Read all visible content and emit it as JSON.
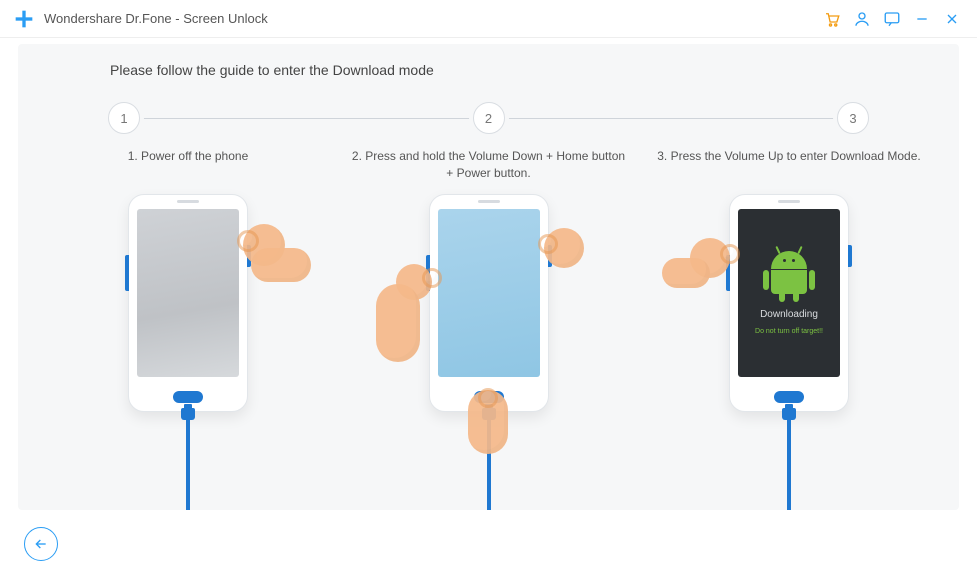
{
  "titlebar": {
    "app_title": "Wondershare Dr.Fone - Screen Unlock"
  },
  "guide": {
    "title": "Please follow the guide to enter the Download mode",
    "steps": {
      "s1": {
        "num": "1",
        "caption": "1. Power off the phone"
      },
      "s2": {
        "num": "2",
        "caption": "2. Press and hold the Volume Down + Home button + Power button."
      },
      "s3": {
        "num": "3",
        "caption": "3. Press the Volume Up to enter Download Mode."
      }
    },
    "download_screen": {
      "label": "Downloading",
      "sub": "Do not turn off target!!"
    }
  }
}
